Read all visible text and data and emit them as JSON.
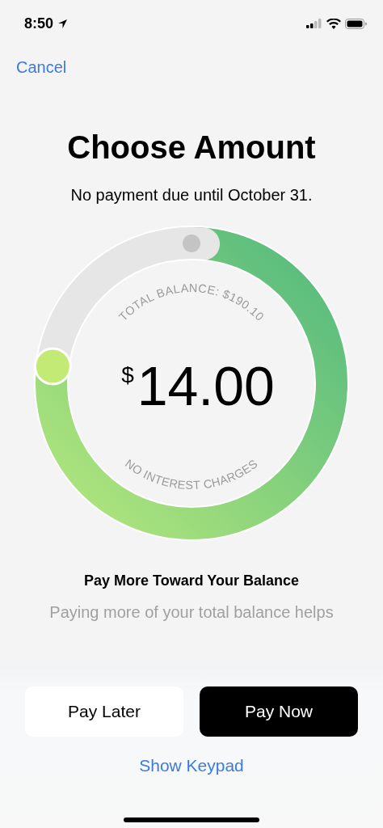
{
  "status_bar": {
    "time": "8:50"
  },
  "nav": {
    "cancel": "Cancel"
  },
  "title": "Choose Amount",
  "subtitle": "No payment due until October 31.",
  "dial": {
    "currency": "$",
    "amount": "14.00",
    "top_label": "TOTAL BALANCE: $190.10",
    "bottom_label": "NO INTEREST CHARGES"
  },
  "info": {
    "heading": "Pay More Toward Your Balance",
    "body": "Paying more of your total balance helps"
  },
  "buttons": [
    {
      "label": "Pay Later",
      "kind": "secondary"
    },
    {
      "label": "Pay Now",
      "kind": "primary"
    }
  ],
  "link": "Show Keypad"
}
